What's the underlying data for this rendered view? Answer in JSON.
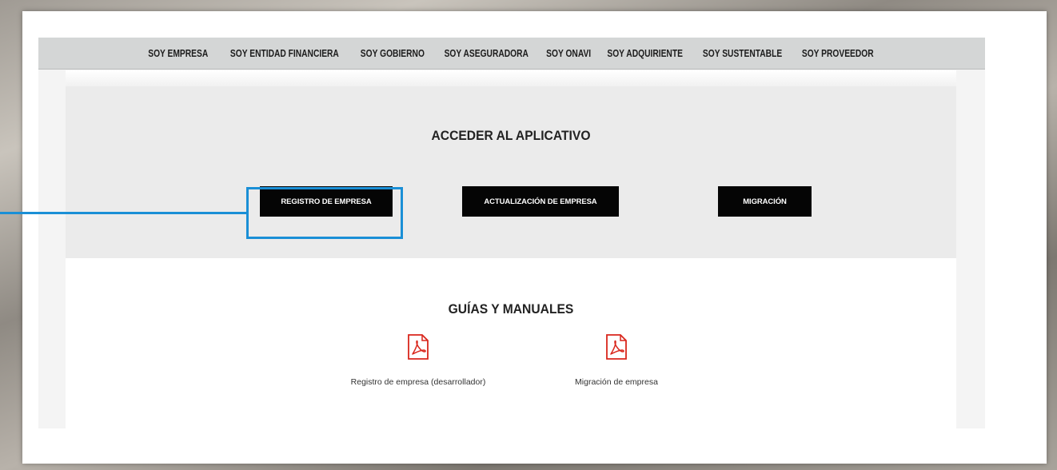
{
  "nav": {
    "items": [
      {
        "label": "SOY EMPRESA"
      },
      {
        "label": "SOY ENTIDAD FINANCIERA"
      },
      {
        "label": "SOY GOBIERNO"
      },
      {
        "label": "SOY ASEGURADORA"
      },
      {
        "label": "SOY ONAVI"
      },
      {
        "label": "SOY ADQUIRIENTE"
      },
      {
        "label": "SOY SUSTENTABLE"
      },
      {
        "label": "SOY PROVEEDOR"
      }
    ]
  },
  "apps": {
    "title": "ACCEDER AL APLICATIVO",
    "buttons": [
      {
        "label": "REGISTRO DE EMPRESA"
      },
      {
        "label": "ACTUALIZACIÓN DE EMPRESA"
      },
      {
        "label": "MIGRACIÓN"
      }
    ],
    "highlight_color": "#1a8fd6"
  },
  "guides": {
    "title": "GUÍAS Y MANUALES",
    "docs": [
      {
        "label": "Registro de empresa (desarrollador)",
        "icon": "pdf-icon"
      },
      {
        "label": "Migración de empresa",
        "icon": "pdf-icon"
      }
    ],
    "icon_color": "#d9261c"
  }
}
